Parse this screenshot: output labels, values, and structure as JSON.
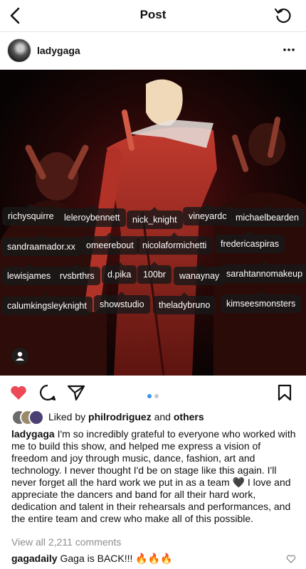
{
  "header": {
    "title": "Post"
  },
  "post": {
    "username": "ladygaga",
    "tags": [
      "richysquirre",
      "leleroybennett",
      "nick_knight",
      "vineyardc",
      "michaelbearden",
      "sandraamador.xx",
      "omeerebout",
      "nicolaformichetti",
      "fredericaspiras",
      "lewisjames",
      "rvsbrthrs",
      "d.pika",
      "100br",
      "wanaynay",
      "sarahtannomakeup",
      "calumkingsleyknight",
      "showstudio",
      "theladybruno",
      "kimseesmonsters"
    ],
    "likes": {
      "prefix": "Liked by",
      "user": "philrodriguez",
      "and": "and",
      "others": "others"
    },
    "caption_user": "ladygaga",
    "caption_text": "I'm so incredibly grateful to everyone who worked with me to build this show, and helped me express a vision of freedom and joy through music, dance, fashion, art and technology.  I never thought I'd be on stage like this again. I'll never forget all the hard work we put in as a team 🖤  I love and appreciate the dancers and band for all their hard work, dedication and talent in their rehearsals and performances, and the entire team and crew who make all of this possible.",
    "view_comments": "View all 2,211 comments",
    "comment": {
      "user": "gagadaily",
      "text": "Gaga is BACK!!! 🔥🔥🔥"
    }
  },
  "colors": {
    "like_red": "#ed4956",
    "active_dot": "#3897f0",
    "inactive_dot": "#c7c7c7",
    "muted_text": "#8e8e8e"
  },
  "icons": [
    "back-arrow-icon",
    "refresh-icon",
    "more-options-icon",
    "heart-icon",
    "comment-icon",
    "share-icon",
    "bookmark-icon",
    "person-tag-icon"
  ]
}
